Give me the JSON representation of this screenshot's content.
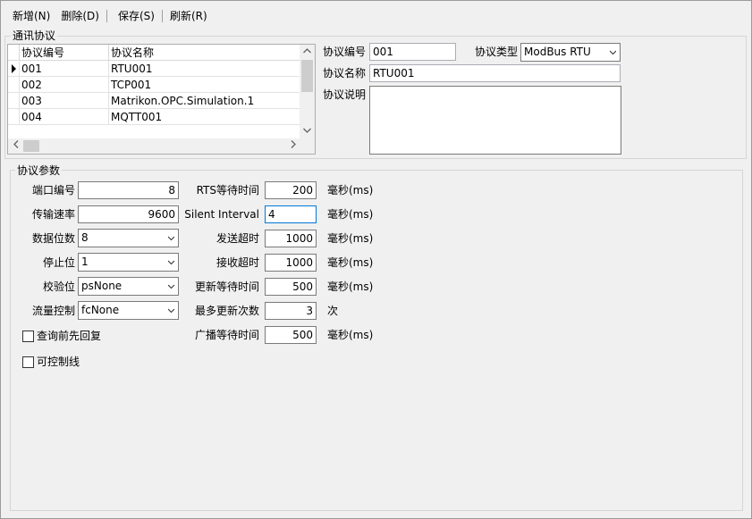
{
  "toolbar": {
    "new_label": "新增(N)",
    "delete_label": "删除(D)",
    "save_label": "保存(S)",
    "refresh_label": "刷新(R)"
  },
  "protocol_group": {
    "title": "通讯协议",
    "grid": {
      "columns": [
        "协议编号",
        "协议名称"
      ],
      "rows": [
        {
          "id": "001",
          "name": "RTU001",
          "current": true
        },
        {
          "id": "002",
          "name": "TCP001",
          "current": false
        },
        {
          "id": "003",
          "name": "Matrikon.OPC.Simulation.1",
          "current": false
        },
        {
          "id": "004",
          "name": "MQTT001",
          "current": false
        }
      ]
    },
    "form": {
      "id_label": "协议编号",
      "id_value": "001",
      "type_label": "协议类型",
      "type_value": "ModBus RTU",
      "name_label": "协议名称",
      "name_value": "RTU001",
      "desc_label": "协议说明",
      "desc_value": ""
    }
  },
  "params_group": {
    "title": "协议参数",
    "left": {
      "port_label": "端口编号",
      "port_value": "8",
      "baud_label": "传输速率",
      "baud_value": "9600",
      "databits_label": "数据位数",
      "databits_value": "8",
      "stopbits_label": "停止位",
      "stopbits_value": "1",
      "parity_label": "校验位",
      "parity_value": "psNone",
      "flow_label": "流量控制",
      "flow_value": "fcNone",
      "query_reply_label": "查询前先回复",
      "query_reply_checked": false,
      "controllable_label": "可控制线",
      "controllable_checked": false
    },
    "right": {
      "rts_label": "RTS等待时间",
      "rts_value": "200",
      "rts_unit": "毫秒(ms)",
      "silent_label": "Silent Interval",
      "silent_value": "4",
      "silent_unit": "毫秒(ms)",
      "send_label": "发送超时",
      "send_value": "1000",
      "send_unit": "毫秒(ms)",
      "recv_label": "接收超时",
      "recv_value": "1000",
      "recv_unit": "毫秒(ms)",
      "update_wait_label": "更新等待时间",
      "update_wait_value": "500",
      "update_wait_unit": "毫秒(ms)",
      "max_update_label": "最多更新次数",
      "max_update_value": "3",
      "max_update_unit": "次",
      "broadcast_label": "广播等待时间",
      "broadcast_value": "500",
      "broadcast_unit": "毫秒(ms)"
    }
  }
}
